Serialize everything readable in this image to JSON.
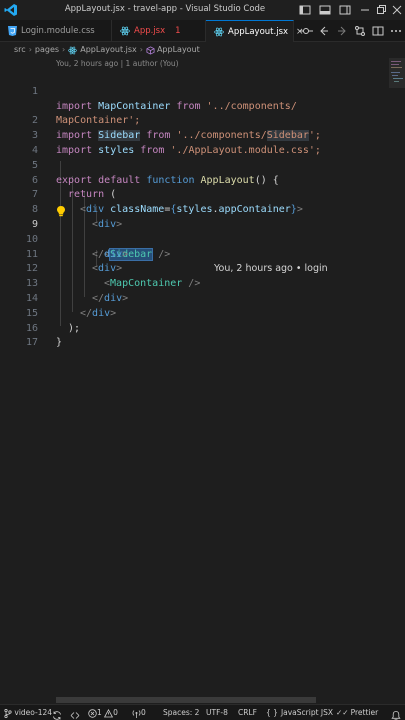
{
  "titlebar": {
    "title": "AppLayout.jsx - travel-app - Visual Studio Code"
  },
  "tabs": [
    {
      "label": "Login.module.css",
      "icon": "css-icon",
      "badge": "",
      "active": false
    },
    {
      "label": "App.jsx",
      "icon": "react-icon",
      "badge": "1",
      "active": false
    },
    {
      "label": "AppLayout.jsx",
      "icon": "react-icon",
      "badge": "",
      "active": true
    }
  ],
  "tab_close_glyph": "×",
  "breadcrumb": {
    "items": [
      "src",
      "pages",
      "AppLayout.jsx",
      "AppLayout"
    ],
    "separator": "›"
  },
  "codelens": "You, 2 hours ago | 1 author (You)",
  "editor": {
    "line_numbers": [
      "1",
      "",
      "2",
      "3",
      "4",
      "5",
      "6",
      "7",
      "8",
      "9",
      "10",
      "11",
      "12",
      "13",
      "14",
      "15",
      "16",
      "17"
    ],
    "current_line": "9",
    "blame": "You, 2 hours ago • login"
  },
  "code": {
    "l1a": "import ",
    "l1b": "MapContainer",
    "l1c": " from ",
    "l1d": "'../components/",
    "l1e": "MapContainer';",
    "l2a": "import ",
    "l2b": "Sidebar",
    "l2c": " from ",
    "l2d": "'../components/",
    "l2e": "Sidebar",
    "l2f": "';",
    "l3a": "import ",
    "l3b": "styles",
    "l3c": " from ",
    "l3d": "'./AppLayout.module.css';",
    "l5a": "export ",
    "l5b": "default ",
    "l5c": "function ",
    "l5d": "AppLayout",
    "l5e": "() {",
    "l6a": "return",
    "l6b": " (",
    "l7a": "<",
    "l7b": "div",
    "l7c": " className",
    "l7d": "=",
    "l7e": "{",
    "l7f": "styles",
    "l7g": ".",
    "l7h": "appContainer",
    "l7i": "}",
    "l7j": ">",
    "l8a": "<",
    "l8b": "div",
    "l8c": ">",
    "l9a": "<",
    "l9b": "Sidebar",
    "l9c": " />",
    "l10a": "</",
    "l10b": "div",
    "l10c": ">",
    "l11a": "<",
    "l11b": "div",
    "l11c": ">",
    "l12a": "<",
    "l12b": "MapContainer",
    "l12c": " />",
    "l13a": "</",
    "l13b": "div",
    "l13c": ">",
    "l14a": "</",
    "l14b": "div",
    "l14c": ">",
    "l15a": ");",
    "l16a": "}"
  },
  "statusbar": {
    "branch": "video-124",
    "errors": "1",
    "warnings": "0",
    "ports": "0",
    "spaces": "Spaces: 2",
    "encoding": "UTF-8",
    "eol": "CRLF",
    "language": "JavaScript JSX",
    "formatter": "Prettier"
  },
  "colors": {
    "accent": "#0078d4",
    "keyword": "#c586c0",
    "keyword2": "#569cd6",
    "function": "#dcdcaa",
    "variable": "#9cdcfe",
    "string": "#ce9178",
    "component": "#4ec9b0",
    "error": "#f14c4c"
  }
}
